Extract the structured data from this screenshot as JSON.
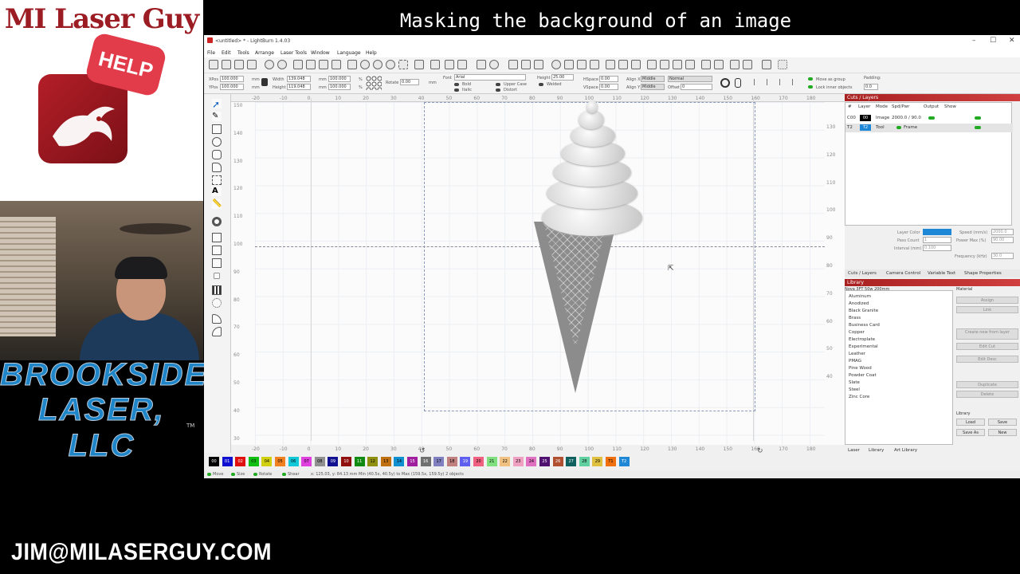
{
  "branding": {
    "title": "MI Laser Guy",
    "help_badge": "HELP",
    "company_line1": "BROOKSIDE",
    "company_line2": "LASER, LLC",
    "trademark": "TM",
    "email": "JIM@MILASERGUY.COM"
  },
  "video_title": "Masking the background of an image",
  "window": {
    "title": "<untitled> * - LightBurn 1.4.03",
    "controls": [
      "–",
      "☐",
      "✕"
    ]
  },
  "menu": [
    "File",
    "Edit",
    "Tools",
    "Arrange",
    "Laser Tools",
    "Window",
    "Language",
    "Help"
  ],
  "toolbar2": {
    "xpos_label": "XPos",
    "xpos_value": "100.000",
    "ypos_label": "YPos",
    "ypos_value": "100.000",
    "width_label": "Width",
    "width_value": "139.048",
    "height_label": "Height",
    "height_value": "119.048",
    "scale_w": "100.000",
    "scale_h": "100.000",
    "unit": "mm",
    "percent": "%",
    "rotate_label": "Rotate",
    "rotate_value": "0.00",
    "font_label": "Font",
    "font_value": "Arial",
    "height2_label": "Height",
    "height2_value": "25.00",
    "hspace_label": "HSpace",
    "hspace_value": "0.00",
    "vspace_label": "VSpace",
    "vspace_value": "0.00",
    "alignx_label": "Align X",
    "alignx_value": "Middle",
    "aligny_label": "Align Y",
    "aligny_value": "Middle",
    "normal_value": "Normal",
    "offset_label": "Offset",
    "offset_value": "0",
    "bold": "Bold",
    "italic": "Italic",
    "upper_case": "Upper Case",
    "distort": "Distort",
    "welded": "Welded",
    "move_as_group": "Move as group",
    "lock_inner": "Lock inner objects",
    "padding_label": "Padding:",
    "padding_value": "0.0"
  },
  "rulers": {
    "top": [
      "-20",
      "-10",
      "0",
      "10",
      "20",
      "30",
      "40",
      "50",
      "60",
      "70",
      "80",
      "90",
      "100",
      "110",
      "120",
      "130",
      "140",
      "150",
      "160",
      "170",
      "180"
    ],
    "left": [
      "150",
      "140",
      "130",
      "120",
      "110",
      "100",
      "90",
      "80",
      "70",
      "60",
      "50",
      "40",
      "30"
    ],
    "right": [
      "130",
      "120",
      "110",
      "100",
      "90",
      "80",
      "70",
      "60",
      "50",
      "40"
    ]
  },
  "cuts_layers": {
    "panel_title": "Cuts / Layers",
    "headers": [
      "#",
      "Layer",
      "Mode",
      "Spd/Pwr",
      "Output",
      "Show"
    ],
    "rows": [
      {
        "num": "C00",
        "chip": "00",
        "chip_color": "#000000",
        "mode": "Image",
        "spdpwr": "2000.0 / 90.0"
      },
      {
        "num": "T2",
        "chip": "T2",
        "chip_color": "#1e88d6",
        "mode": "Tool",
        "spdpwr": "Frame"
      }
    ],
    "layer_color_label": "Layer Color",
    "speed_label": "Speed (mm/s)",
    "speed_value": "2000.0",
    "pass_count_label": "Pass Count",
    "pass_count_value": "1",
    "power_max_label": "Power Max (%)",
    "power_max_value": "90.00",
    "interval_label": "Interval (mm)",
    "interval_value": "0.100",
    "frequency_label": "Frequency (kHz)",
    "frequency_value": "30.0",
    "layer_color": "#1e88d6"
  },
  "panel_tabs": [
    "Cuts / Layers",
    "Camera Control",
    "Variable Text",
    "Shape Properties"
  ],
  "library": {
    "panel_title": "Library",
    "device": "Nova 3FT 50w 200mm",
    "material_label": "Material",
    "items": [
      "Aluminum",
      "Anodized",
      "Black Granite",
      "Brass",
      "Business Card",
      "Copper",
      "Electroplate",
      "Experimental",
      "Leather",
      "PMAG",
      "Pine Wood",
      "Powder Coat",
      "Slate",
      "Steel",
      "Zinc Core"
    ],
    "buttons": [
      "Assign",
      "Link",
      "Create new from layer",
      "Edit Cut",
      "Edit Desc",
      "Duplicate",
      "Delete"
    ],
    "library_label": "Library",
    "file_buttons": [
      "Load",
      "Save",
      "Save As",
      "New"
    ]
  },
  "bottom_tabs": [
    "Laser",
    "Library",
    "Art Library"
  ],
  "palette": [
    {
      "label": "00",
      "color": "#000000",
      "text": "#fff"
    },
    {
      "label": "01",
      "color": "#1010d0",
      "text": "#fff"
    },
    {
      "label": "02",
      "color": "#e01010",
      "text": "#fff"
    },
    {
      "label": "03",
      "color": "#10c010",
      "text": "#000"
    },
    {
      "label": "04",
      "color": "#d0d010",
      "text": "#000"
    },
    {
      "label": "05",
      "color": "#f08020",
      "text": "#000"
    },
    {
      "label": "06",
      "color": "#10c8d8",
      "text": "#000"
    },
    {
      "label": "07",
      "color": "#e040e0",
      "text": "#000"
    },
    {
      "label": "08",
      "color": "#909090",
      "text": "#000"
    },
    {
      "label": "09",
      "color": "#101090",
      "text": "#fff"
    },
    {
      "label": "10",
      "color": "#901010",
      "text": "#fff"
    },
    {
      "label": "11",
      "color": "#108a10",
      "text": "#fff"
    },
    {
      "label": "12",
      "color": "#909010",
      "text": "#000"
    },
    {
      "label": "13",
      "color": "#c07010",
      "text": "#000"
    },
    {
      "label": "14",
      "color": "#1090d0",
      "text": "#000"
    },
    {
      "label": "15",
      "color": "#a020a0",
      "text": "#fff"
    },
    {
      "label": "16",
      "color": "#707070",
      "text": "#fff"
    },
    {
      "label": "17",
      "color": "#8080c0",
      "text": "#000"
    },
    {
      "label": "18",
      "color": "#c08080",
      "text": "#000"
    },
    {
      "label": "19",
      "color": "#6060f0",
      "text": "#fff"
    },
    {
      "label": "20",
      "color": "#f06080",
      "text": "#000"
    },
    {
      "label": "21",
      "color": "#80e080",
      "text": "#000"
    },
    {
      "label": "22",
      "color": "#f0c080",
      "text": "#000"
    },
    {
      "label": "23",
      "color": "#f0a0c0",
      "text": "#000"
    },
    {
      "label": "24",
      "color": "#e070c0",
      "text": "#000"
    },
    {
      "label": "25",
      "color": "#501070",
      "text": "#fff"
    },
    {
      "label": "26",
      "color": "#b05030",
      "text": "#fff"
    },
    {
      "label": "27",
      "color": "#106060",
      "text": "#fff"
    },
    {
      "label": "28",
      "color": "#60d0a0",
      "text": "#000"
    },
    {
      "label": "29",
      "color": "#e0c040",
      "text": "#000"
    },
    {
      "label": "T1",
      "color": "#f07010",
      "text": "#000"
    },
    {
      "label": "T2",
      "color": "#1e88d6",
      "text": "#fff"
    }
  ],
  "status": {
    "move": "Move",
    "size": "Size",
    "rotate": "Rotate",
    "shear": "Shear",
    "coords": "x: 125.03, y: 84.13 mm   Min (40.5x, 40.5y) to Max (159.5x, 159.5y)  2 objects"
  }
}
